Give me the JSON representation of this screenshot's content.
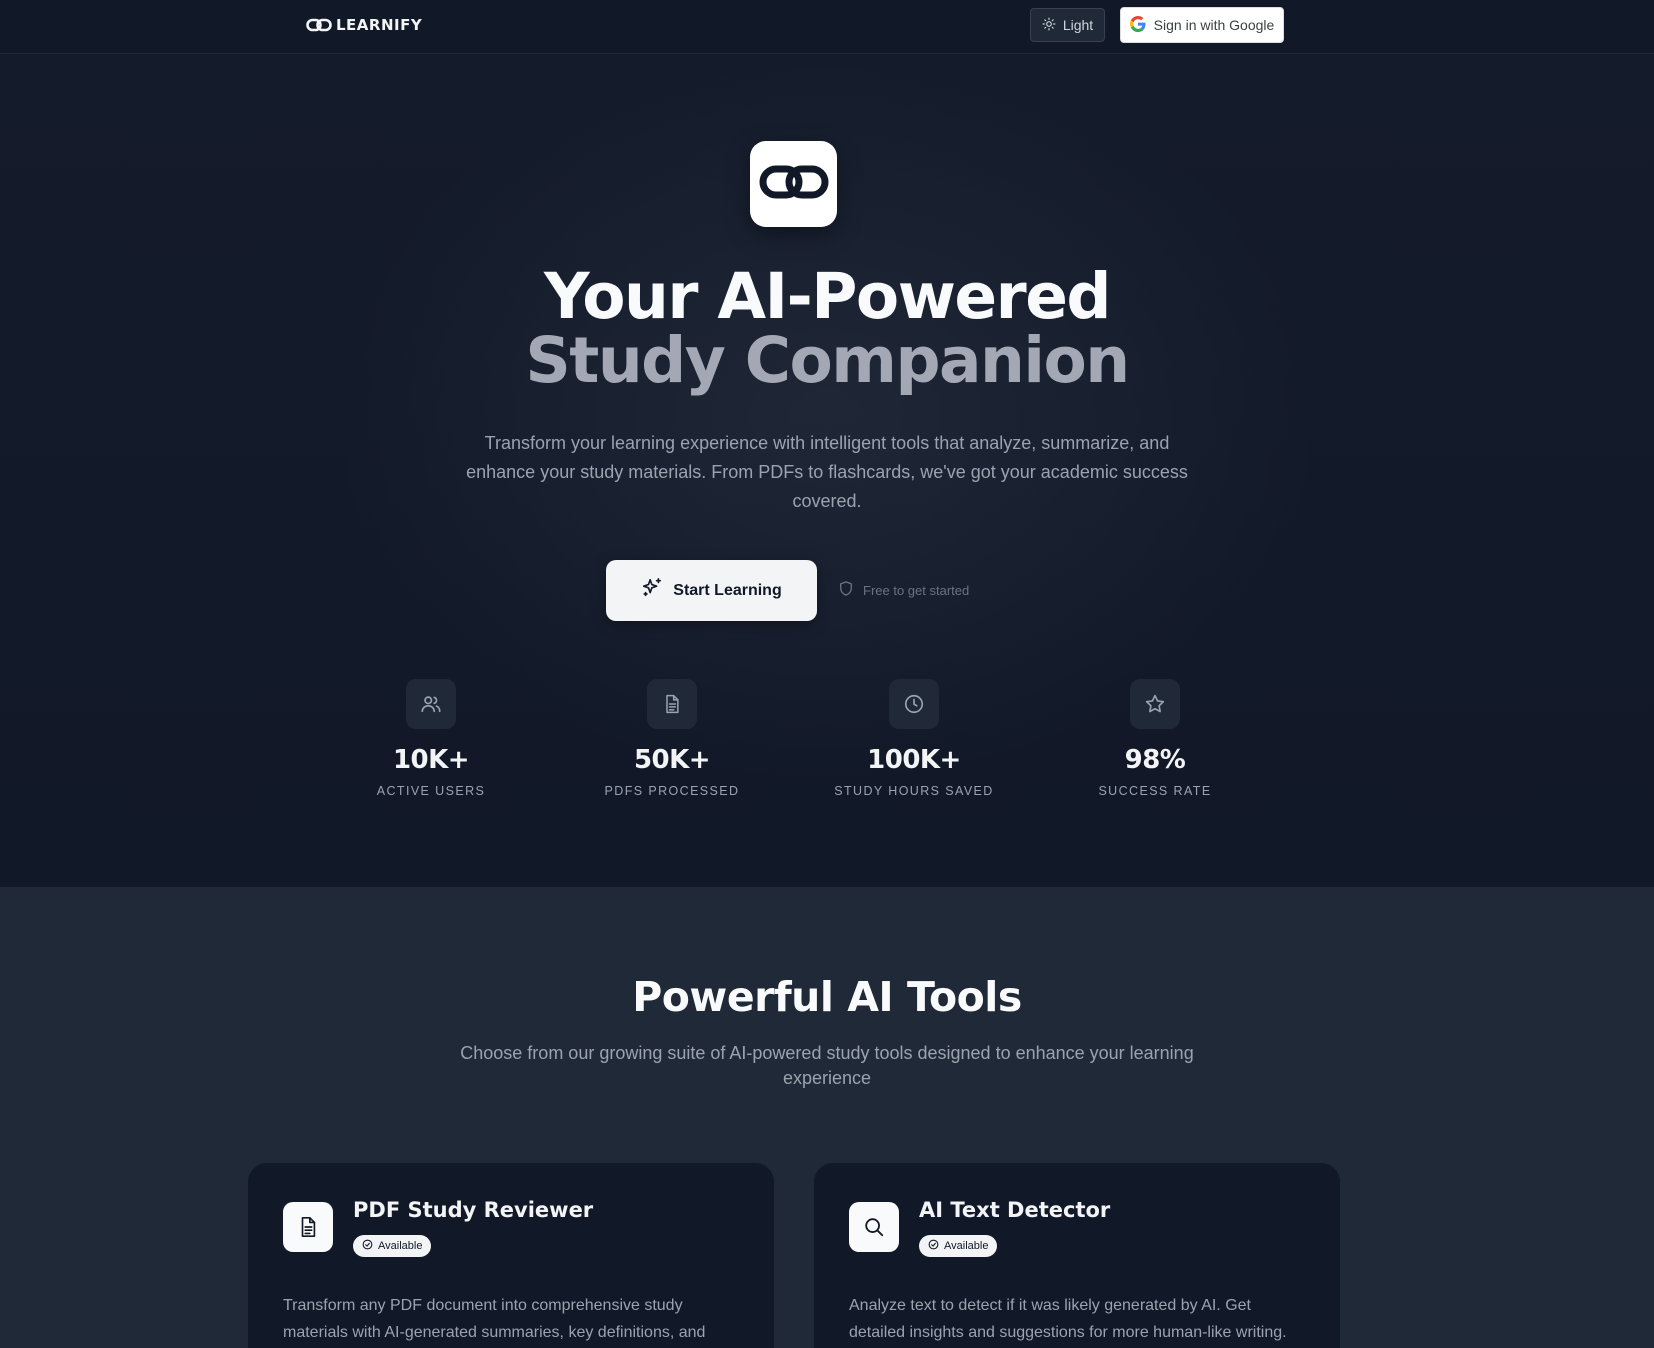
{
  "nav": {
    "brand": "LEARNIFY",
    "theme_label": "Light",
    "google_label": "Sign in with Google"
  },
  "hero": {
    "headline_line1": "Your AI-Powered",
    "headline_line2": "Study Companion",
    "subtitle": "Transform your learning experience with intelligent tools that analyze, summarize, and enhance your study materials. From PDFs to flashcards, we've got your academic success covered.",
    "cta_label": "Start Learning",
    "free_note": "Free to get started"
  },
  "stats": [
    {
      "icon": "users-icon",
      "value": "10K+",
      "label": "ACTIVE USERS"
    },
    {
      "icon": "document-icon",
      "value": "50K+",
      "label": "PDFS PROCESSED"
    },
    {
      "icon": "clock-icon",
      "value": "100K+",
      "label": "STUDY HOURS SAVED"
    },
    {
      "icon": "star-icon",
      "value": "98%",
      "label": "SUCCESS RATE"
    }
  ],
  "tools": {
    "title": "Powerful AI Tools",
    "subtitle": "Choose from our growing suite of AI-powered study tools designed to enhance your learning experience",
    "cards": [
      {
        "icon": "document-icon",
        "title": "PDF Study Reviewer",
        "badge": "Available",
        "description": "Transform any PDF document into comprehensive study materials with AI-generated summaries, key definitions, and practice questions."
      },
      {
        "icon": "search-icon",
        "title": "AI Text Detector",
        "badge": "Available",
        "description": "Analyze text to detect if it was likely generated by AI. Get detailed insights and suggestions for more human-like writing."
      }
    ]
  },
  "colors": {
    "background": "#111827",
    "section_alt": "#1f2937",
    "accent_light": "#f3f4f6",
    "muted_text": "#9ca3af"
  }
}
